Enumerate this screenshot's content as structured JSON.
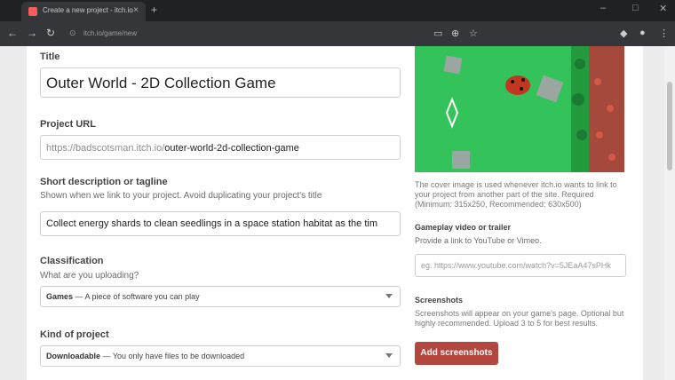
{
  "browser": {
    "tab_title": "Create a new project - itch.io",
    "new_tab": "+",
    "tab_close": "×",
    "url": "itch.io/game/new",
    "win_min": "–",
    "win_max": "□",
    "win_close": "✕"
  },
  "form": {
    "title_label": "Title",
    "title_value": "Outer World - 2D Collection Game",
    "url_label": "Project URL",
    "url_prefix": "https://badscotsman.itch.io/",
    "url_slug": "outer-world-2d-collection-game",
    "tagline_label": "Short description or tagline",
    "tagline_help": "Shown when we link to your project. Avoid duplicating your project's title",
    "tagline_value": "Collect energy shards to clean seedlings in a space  station habitat as the tim",
    "classification_label": "Classification",
    "classification_help": "What are you uploading?",
    "classification_value": "Games",
    "classification_desc": " — A piece of software you can play",
    "kind_label": "Kind of project",
    "kind_value": "Downloadable",
    "kind_desc": " — You only have files to be downloaded"
  },
  "side": {
    "cover_help": "The cover image is used whenever itch.io wants to link to your project from another part of the site. Required (Minimum: 315x250, Recommended: 630x500)",
    "video_label": "Gameplay video or trailer",
    "video_help": "Provide a link to YouTube or Vimeo.",
    "video_placeholder": "eg. https://www.youtube.com/watch?v=5JEaA47sPHk",
    "screens_label": "Screenshots",
    "screens_help": "Screenshots will appear on your game's page. Optional but highly recommended. Upload 3 to 5 for best results.",
    "screens_button": "Add screenshots"
  },
  "colors": {
    "accent": "#b3473f",
    "cover_bg": "#2bb04a"
  }
}
